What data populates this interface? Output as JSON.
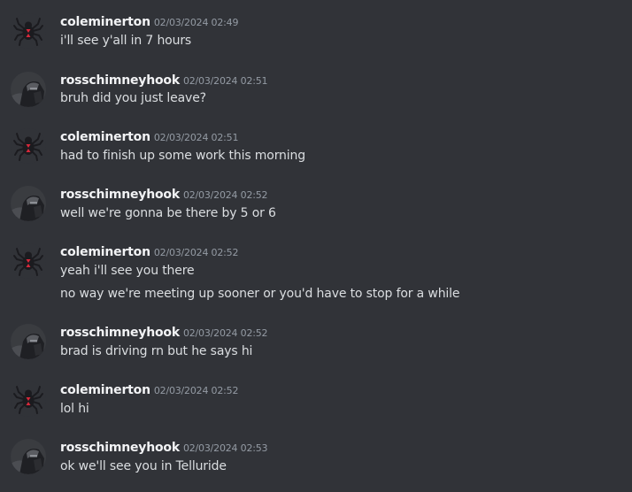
{
  "colors": {
    "background": "#313338",
    "username": "#f2f3f5",
    "timestamp": "#949ba4",
    "text": "#dbdee1"
  },
  "messages": [
    {
      "author": "coleminerton",
      "avatar": "spider-avatar",
      "timestamp": "02/03/2024 02:49",
      "lines": [
        "i'll see y'all in 7 hours"
      ]
    },
    {
      "author": "rosschimneyhook",
      "avatar": "armored-figure-avatar",
      "timestamp": "02/03/2024 02:51",
      "lines": [
        "bruh did you just leave?"
      ]
    },
    {
      "author": "coleminerton",
      "avatar": "spider-avatar",
      "timestamp": "02/03/2024 02:51",
      "lines": [
        "had to finish up some work this morning"
      ]
    },
    {
      "author": "rosschimneyhook",
      "avatar": "armored-figure-avatar",
      "timestamp": "02/03/2024 02:52",
      "lines": [
        "well we're gonna be there by 5 or 6"
      ]
    },
    {
      "author": "coleminerton",
      "avatar": "spider-avatar",
      "timestamp": "02/03/2024 02:52",
      "lines": [
        "yeah i'll see you there",
        "no way we're meeting up sooner or you'd have to stop for a while"
      ]
    },
    {
      "author": "rosschimneyhook",
      "avatar": "armored-figure-avatar",
      "timestamp": "02/03/2024 02:52",
      "lines": [
        "brad is driving rn but he says hi"
      ]
    },
    {
      "author": "coleminerton",
      "avatar": "spider-avatar",
      "timestamp": "02/03/2024 02:52",
      "lines": [
        "lol hi"
      ]
    },
    {
      "author": "rosschimneyhook",
      "avatar": "armored-figure-avatar",
      "timestamp": "02/03/2024 02:53",
      "lines": [
        "ok we'll see you in Telluride"
      ]
    }
  ]
}
